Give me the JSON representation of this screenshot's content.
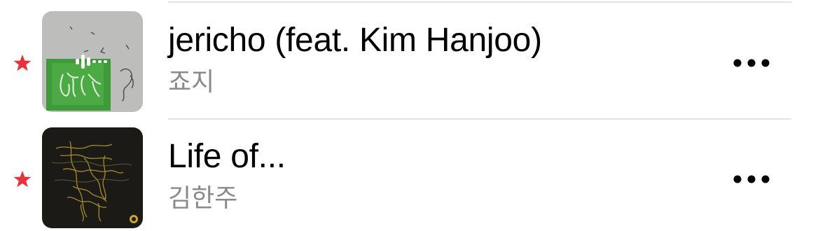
{
  "colors": {
    "favorite_star": "#e5323b",
    "title": "#000000",
    "artist": "#8a8a8e",
    "divider": "#e4e4e6"
  },
  "songs": [
    {
      "title": "jericho (feat. Kim Hanjoo)",
      "artist": "죠지",
      "favorite": true,
      "now_playing": true,
      "artwork_icon": "album-art-green-figures",
      "more_icon": "ellipsis-icon"
    },
    {
      "title": "Life of...",
      "artist": "김한주",
      "favorite": true,
      "now_playing": false,
      "artwork_icon": "album-art-dark-gold-sketch",
      "more_icon": "ellipsis-icon"
    }
  ]
}
